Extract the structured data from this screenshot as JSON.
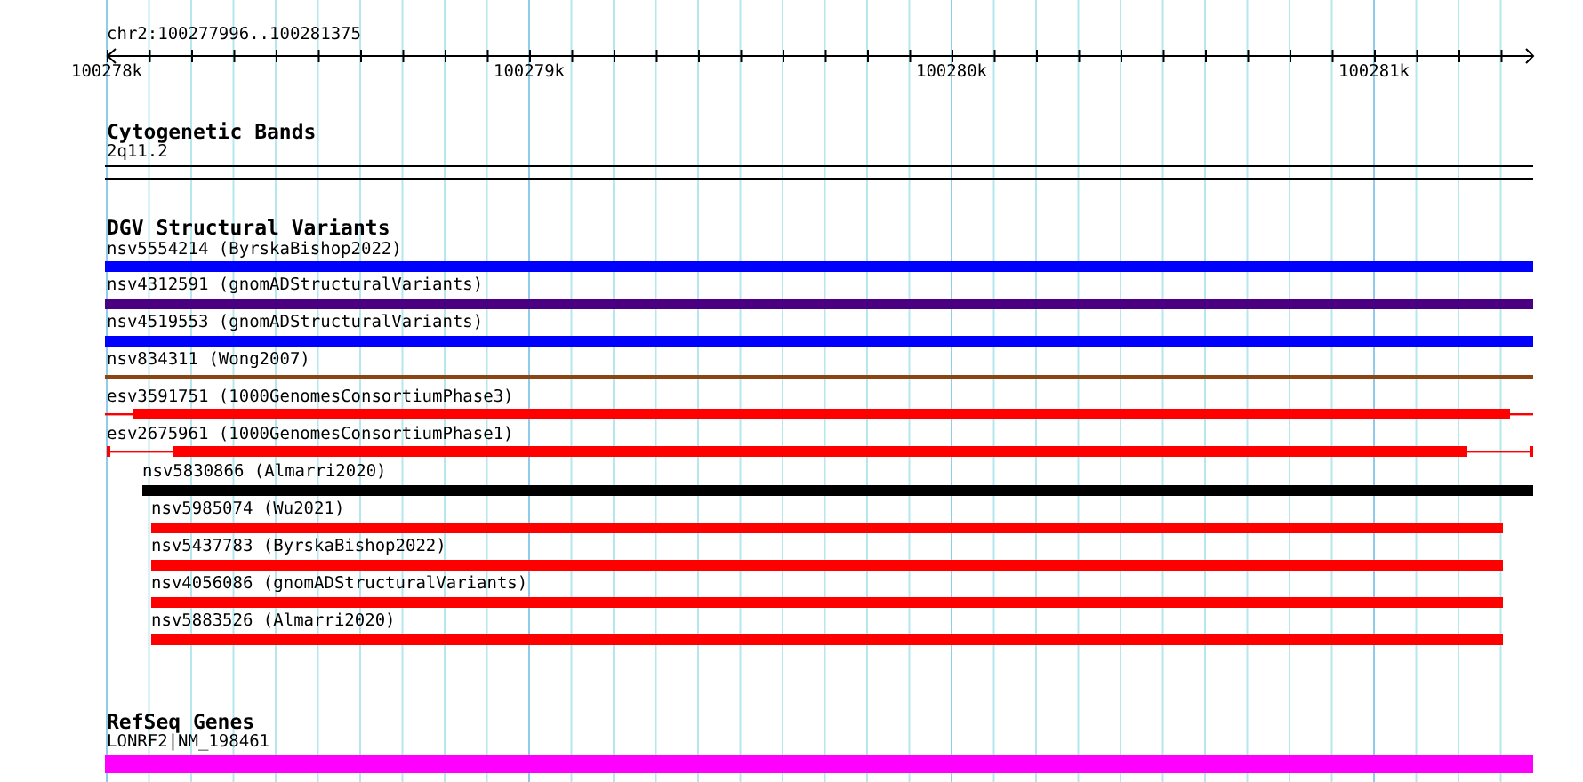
{
  "ruler": {
    "location": "chr2:100277996..100281375",
    "labels": [
      "100278k",
      "100279k",
      "100280k",
      "100281k"
    ]
  },
  "tracks": [
    {
      "title": "Cytogenetic Bands",
      "features": [
        {
          "label": "2q11.2",
          "kind": "outline",
          "color": "#000000"
        }
      ]
    },
    {
      "title": "DGV Structural Variants",
      "features": [
        {
          "label": "nsv5554214 (ByrskaBishop2022)",
          "kind": "bar",
          "color": "#0000ff"
        },
        {
          "label": "nsv4312591 (gnomADStructuralVariants)",
          "kind": "bar",
          "color": "#4b0082"
        },
        {
          "label": "nsv4519553 (gnomADStructuralVariants)",
          "kind": "bar",
          "color": "#0000ff"
        },
        {
          "label": "nsv834311 (Wong2007)",
          "kind": "line",
          "color": "#8b4513"
        },
        {
          "label": "esv3591751 (1000GenomesConsortiumPhase3)",
          "kind": "tailed",
          "color": "#ff0000"
        },
        {
          "label": "esv2675961 (1000GenomesConsortiumPhase1)",
          "kind": "tailed",
          "color": "#ff0000"
        },
        {
          "label": "nsv5830866 (Almarri2020)",
          "kind": "bar",
          "color": "#000000"
        },
        {
          "label": "nsv5985074 (Wu2021)",
          "kind": "bar",
          "color": "#ff0000"
        },
        {
          "label": "nsv5437783 (ByrskaBishop2022)",
          "kind": "bar",
          "color": "#ff0000"
        },
        {
          "label": "nsv4056086 (gnomADStructuralVariants)",
          "kind": "bar",
          "color": "#ff0000"
        },
        {
          "label": "nsv5883526 (Almarri2020)",
          "kind": "bar",
          "color": "#ff0000"
        }
      ]
    },
    {
      "title": "RefSeq Genes",
      "features": [
        {
          "label": "LONRF2|NM_198461",
          "kind": "gene",
          "color": "#ff00ff"
        }
      ]
    }
  ]
}
